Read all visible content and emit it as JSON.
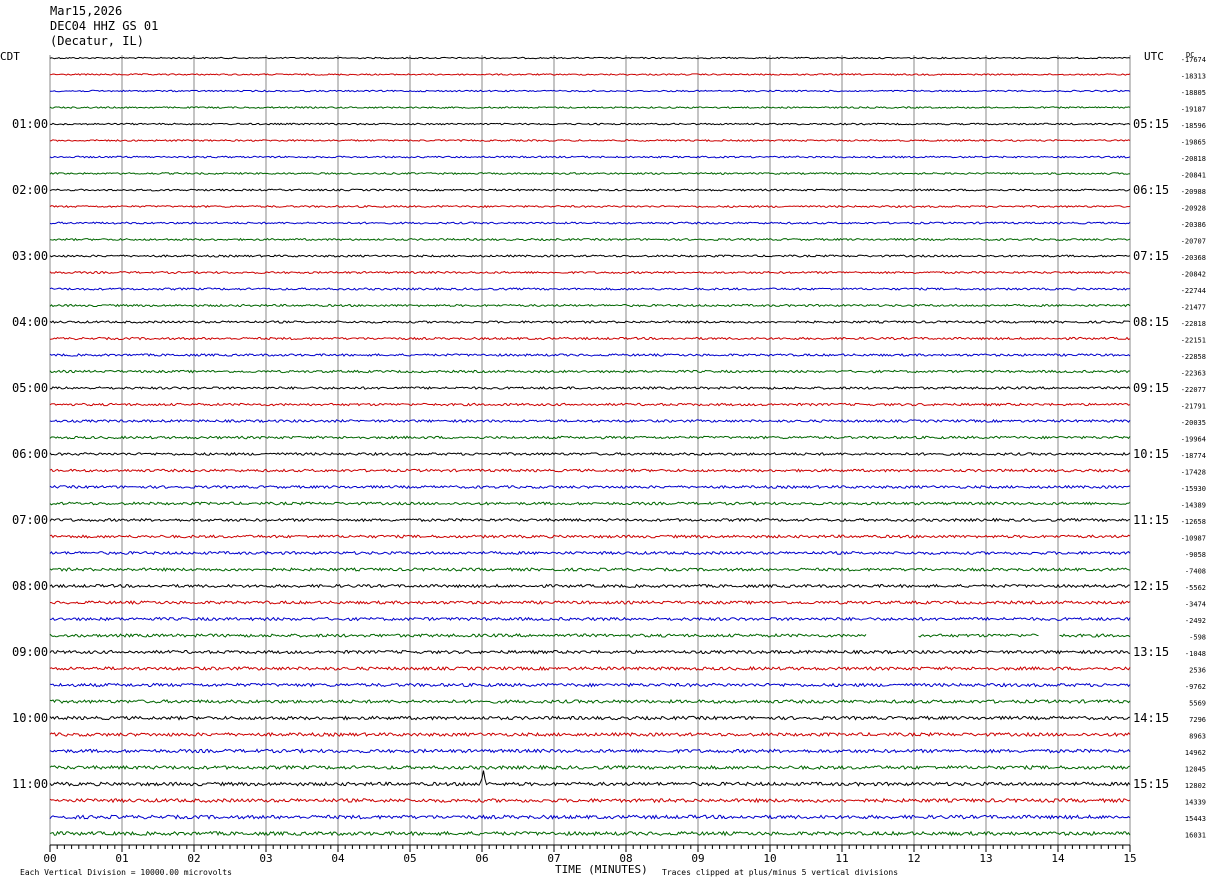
{
  "header": {
    "date": "Mar15,2026",
    "station": "DEC04 HHZ GS 01",
    "location": "(Decatur, IL)"
  },
  "left_timezone": "CDT",
  "right_timezone": "UTC",
  "right_corner": "DC",
  "footer": {
    "scale_note": "Each Vertical Division = 10000.00 microvolts",
    "xaxis_title": "TIME (MINUTES)",
    "clip_note": "Traces clipped at plus/minus 5 vertical divisions"
  },
  "chart_data": {
    "type": "line",
    "title": "DEC04 HHZ GS 01",
    "xlabel": "TIME (MINUTES)",
    "ylabel": "",
    "xlim": [
      0,
      15
    ],
    "x_ticks": [
      "00",
      "01",
      "02",
      "03",
      "04",
      "05",
      "06",
      "07",
      "08",
      "09",
      "10",
      "11",
      "12",
      "13",
      "14",
      "15"
    ],
    "trace_colors": [
      "#000000",
      "#cc0000",
      "#0000cc",
      "#006600"
    ],
    "left_hour_labels": [
      "01:00",
      "02:00",
      "03:00",
      "04:00",
      "05:00",
      "06:00",
      "07:00",
      "08:00",
      "09:00",
      "10:00",
      "11:00"
    ],
    "right_hour_labels": [
      "05:15",
      "06:15",
      "07:15",
      "08:15",
      "09:15",
      "10:15",
      "11:15",
      "12:15",
      "13:15",
      "14:15",
      "15:15"
    ],
    "trace_offsets": [
      "-17674",
      "-18313",
      "-18805",
      "-19187",
      "-18596",
      "-19865",
      "-20818",
      "-20841",
      "-20988",
      "-20928",
      "-20386",
      "-20707",
      "-20368",
      "-20842",
      "-22744",
      "-21477",
      "-22818",
      "-22151",
      "-22858",
      "-22363",
      "-22077",
      "-21791",
      "-20035",
      "-19964",
      "-18774",
      "-17428",
      "-15930",
      "-14389",
      "-12658",
      "-10987",
      "-9058",
      "-7408",
      "-5562",
      "-3474",
      "-2492",
      "-598",
      "-1048",
      "2536",
      "-9762",
      "5569",
      "7296",
      "8963",
      "14962",
      "12045",
      "12802",
      "14339",
      "15443",
      "16031"
    ],
    "gaps": [
      {
        "trace": 35,
        "from_min": 11.35,
        "to_min": 12.05
      },
      {
        "trace": 35,
        "from_min": 13.75,
        "to_min": 14.0
      }
    ],
    "events": [
      {
        "trace": 44,
        "at_min": 6.02,
        "amplitude_div": 1.6
      }
    ],
    "grid": true
  }
}
